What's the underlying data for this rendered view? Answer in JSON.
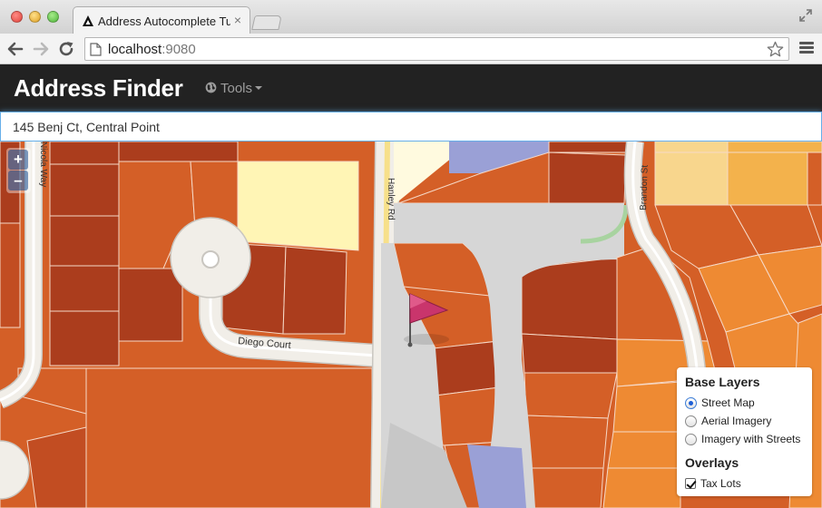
{
  "browser": {
    "tab_title": "Address Autocomplete Tut",
    "tab_close": "×",
    "url_host": "localhost",
    "url_port": ":9080"
  },
  "app": {
    "brand": "Address Finder",
    "tools_label": "Tools"
  },
  "search": {
    "value": "145 Benj Ct, Central Point"
  },
  "map": {
    "zoom_in": "+",
    "zoom_out": "–",
    "streets": [
      "Diego Court",
      "Hanley Rd",
      "Brandon St",
      "Nicola Way"
    ],
    "colors": {
      "dark_lot": "#ab3d1d",
      "mid_lot": "#d45f27",
      "light_lot": "#ee8a33",
      "yellow_lot": "#fff5b5",
      "gold_lot": "#f3b24c",
      "right_of_way": "#d6d6d6",
      "purple_lot": "#9aa0d6",
      "marker": "#c9356c"
    }
  },
  "layers": {
    "base_heading": "Base Layers",
    "base_options": [
      {
        "label": "Street Map",
        "checked": true
      },
      {
        "label": "Aerial Imagery",
        "checked": false
      },
      {
        "label": "Imagery with Streets",
        "checked": false
      }
    ],
    "overlays_heading": "Overlays",
    "overlay_options": [
      {
        "label": "Tax Lots",
        "checked": true
      }
    ]
  }
}
